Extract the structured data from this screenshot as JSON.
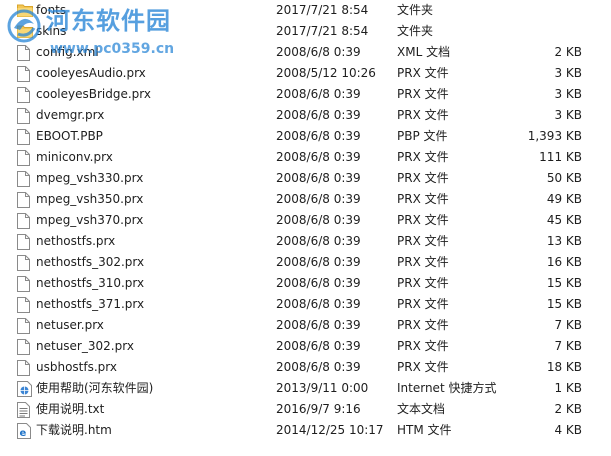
{
  "watermark": {
    "title": "河东软件园",
    "url": "www.pc0359.cn"
  },
  "files": [
    {
      "name": "fonts",
      "date": "2017/7/21 8:54",
      "type": "文件夹",
      "size": "",
      "icon": "folder-icon"
    },
    {
      "name": "skins",
      "date": "2017/7/21 8:54",
      "type": "文件夹",
      "size": "",
      "icon": "folder-icon"
    },
    {
      "name": "config.xml",
      "date": "2008/6/8 0:39",
      "type": "XML 文档",
      "size": "2 KB",
      "icon": "file-icon"
    },
    {
      "name": "cooleyesAudio.prx",
      "date": "2008/5/12 10:26",
      "type": "PRX 文件",
      "size": "3 KB",
      "icon": "file-icon"
    },
    {
      "name": "cooleyesBridge.prx",
      "date": "2008/6/8 0:39",
      "type": "PRX 文件",
      "size": "3 KB",
      "icon": "file-icon"
    },
    {
      "name": "dvemgr.prx",
      "date": "2008/6/8 0:39",
      "type": "PRX 文件",
      "size": "3 KB",
      "icon": "file-icon"
    },
    {
      "name": "EBOOT.PBP",
      "date": "2008/6/8 0:39",
      "type": "PBP 文件",
      "size": "1,393 KB",
      "icon": "file-icon"
    },
    {
      "name": "miniconv.prx",
      "date": "2008/6/8 0:39",
      "type": "PRX 文件",
      "size": "111 KB",
      "icon": "file-icon"
    },
    {
      "name": "mpeg_vsh330.prx",
      "date": "2008/6/8 0:39",
      "type": "PRX 文件",
      "size": "50 KB",
      "icon": "file-icon"
    },
    {
      "name": "mpeg_vsh350.prx",
      "date": "2008/6/8 0:39",
      "type": "PRX 文件",
      "size": "49 KB",
      "icon": "file-icon"
    },
    {
      "name": "mpeg_vsh370.prx",
      "date": "2008/6/8 0:39",
      "type": "PRX 文件",
      "size": "45 KB",
      "icon": "file-icon"
    },
    {
      "name": "nethostfs.prx",
      "date": "2008/6/8 0:39",
      "type": "PRX 文件",
      "size": "13 KB",
      "icon": "file-icon"
    },
    {
      "name": "nethostfs_302.prx",
      "date": "2008/6/8 0:39",
      "type": "PRX 文件",
      "size": "16 KB",
      "icon": "file-icon"
    },
    {
      "name": "nethostfs_310.prx",
      "date": "2008/6/8 0:39",
      "type": "PRX 文件",
      "size": "15 KB",
      "icon": "file-icon"
    },
    {
      "name": "nethostfs_371.prx",
      "date": "2008/6/8 0:39",
      "type": "PRX 文件",
      "size": "15 KB",
      "icon": "file-icon"
    },
    {
      "name": "netuser.prx",
      "date": "2008/6/8 0:39",
      "type": "PRX 文件",
      "size": "7 KB",
      "icon": "file-icon"
    },
    {
      "name": "netuser_302.prx",
      "date": "2008/6/8 0:39",
      "type": "PRX 文件",
      "size": "7 KB",
      "icon": "file-icon"
    },
    {
      "name": "usbhostfs.prx",
      "date": "2008/6/8 0:39",
      "type": "PRX 文件",
      "size": "18 KB",
      "icon": "file-icon"
    },
    {
      "name": "使用帮助(河东软件园)",
      "date": "2013/9/11 0:00",
      "type": "Internet 快捷方式",
      "size": "1 KB",
      "icon": "internet-shortcut-icon"
    },
    {
      "name": "使用说明.txt",
      "date": "2016/9/7 9:16",
      "type": "文本文档",
      "size": "2 KB",
      "icon": "text-file-icon"
    },
    {
      "name": "下载说明.htm",
      "date": "2014/12/25 10:17",
      "type": "HTM 文件",
      "size": "4 KB",
      "icon": "html-file-icon"
    }
  ]
}
